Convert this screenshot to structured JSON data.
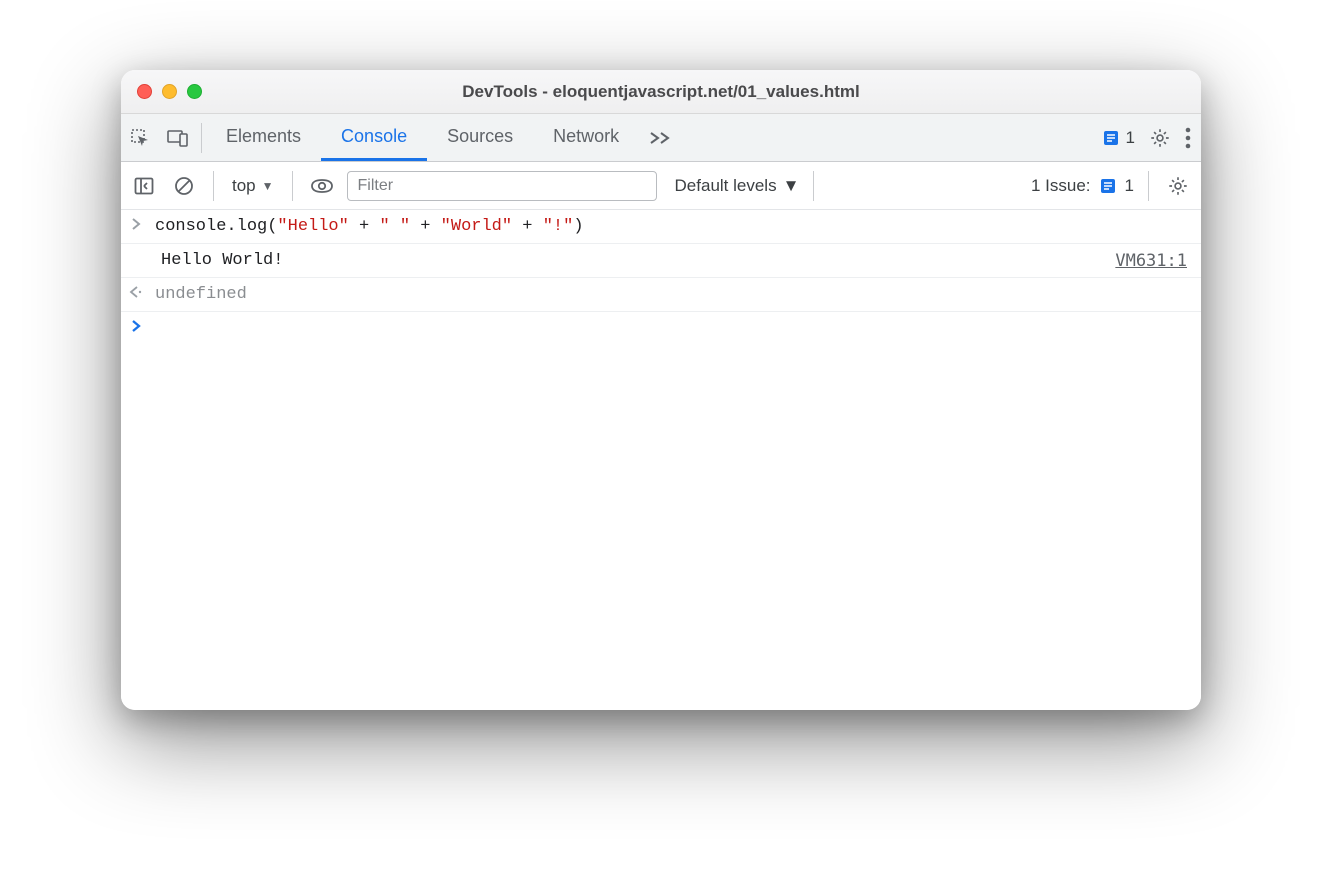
{
  "window": {
    "title": "DevTools - eloquentjavascript.net/01_values.html"
  },
  "tabs": {
    "elements": "Elements",
    "console": "Console",
    "sources": "Sources",
    "network": "Network"
  },
  "header": {
    "issue_count": "1"
  },
  "toolbar": {
    "context": "top",
    "filter_placeholder": "Filter",
    "levels": "Default levels",
    "issues_label": "1 Issue:",
    "issues_count": "1"
  },
  "console": {
    "input_tokens": {
      "call_open": "console.log(",
      "str1": "\"Hello\"",
      "plus": " + ",
      "str2": "\" \"",
      "str3": "\"World\"",
      "str4": "\"!\"",
      "close": ")"
    },
    "log_output": "Hello World!",
    "log_source": "VM631:1",
    "return_value": "undefined"
  }
}
